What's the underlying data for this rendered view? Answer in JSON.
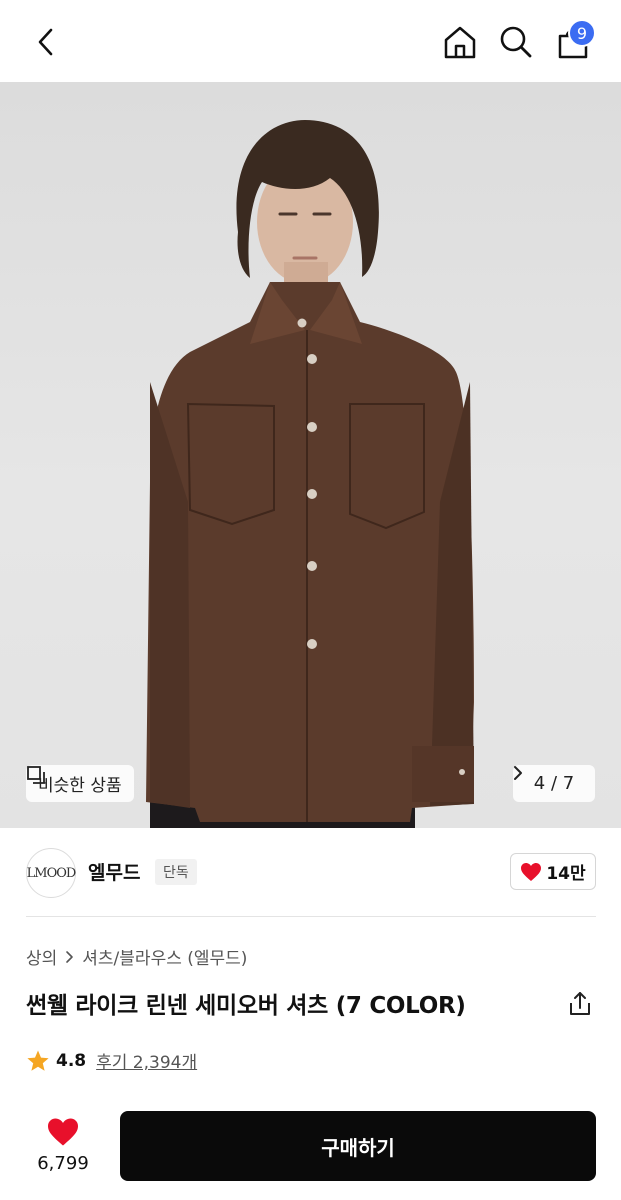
{
  "topbar": {
    "icons": [
      "chevron-left-icon",
      "home-icon",
      "search-icon",
      "bag-icon"
    ],
    "cart_count": "9",
    "badge_color": "#3b6cf2"
  },
  "hero": {
    "similar_label": "비슷한 상품",
    "pager": "4 / 7"
  },
  "brand": {
    "logo_text": "LMOOD",
    "name": "엘무드",
    "tag": "단독",
    "likes": "14만",
    "like_color": "#e8102b"
  },
  "product": {
    "breadcrumb": [
      "상의",
      "셔츠/블라우스 (엘무드)"
    ],
    "title": "썬웰 라이크 린넨 세미오버 셔츠 (7 COLOR)",
    "rating": "4.8",
    "reviews": "후기 2,394개",
    "star_color": "#f5a623"
  },
  "bottom": {
    "like_count": "6,799",
    "buy_label": "구매하기"
  }
}
